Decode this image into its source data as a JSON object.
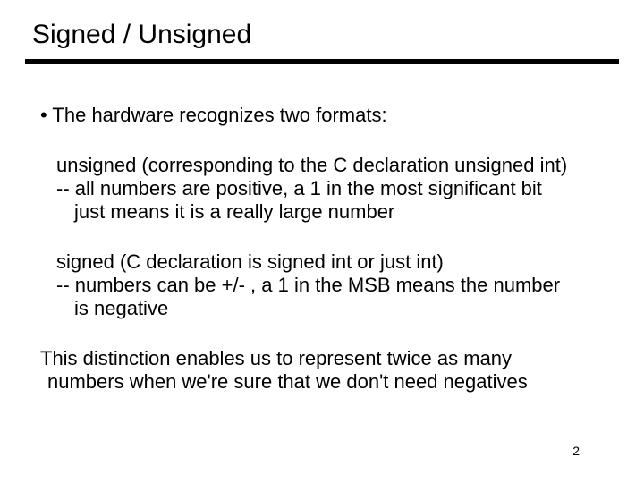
{
  "title": "Signed / Unsigned",
  "bullet": "• The hardware recognizes two formats:",
  "block1": {
    "l1": "unsigned (corresponding to the C declaration  unsigned int)",
    "l2": "-- all numbers are positive, a 1 in the most significant bit",
    "l3": "just means it is a really large number"
  },
  "block2": {
    "l1": "signed (C declaration is  signed int  or just  int)",
    "l2": "-- numbers can be +/-  , a 1 in the MSB means the number",
    "l3": "is negative"
  },
  "block3": {
    "l1": "This distinction enables us to represent twice as many",
    "l2": "numbers when we're sure that we don't need negatives"
  },
  "page_number": "2"
}
